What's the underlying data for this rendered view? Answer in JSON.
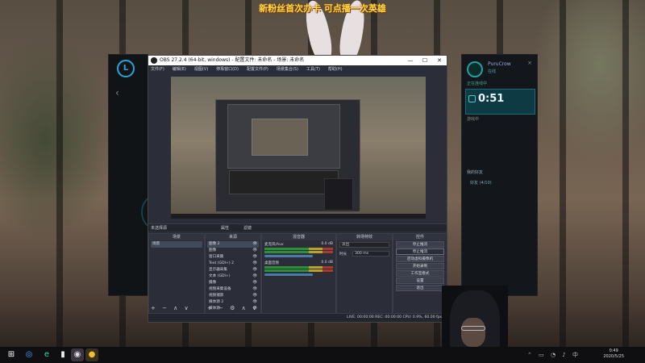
{
  "banner": "新粉丝首次办卡 可点播一次英雄",
  "right_app": {
    "username": "PuruCrow",
    "status": "在线",
    "close": "×",
    "hint_top": "正在连线中",
    "timer": "0:51",
    "hint_below": "游戏中",
    "section": "我的好友",
    "item": "好友 (4/10)"
  },
  "obs": {
    "title": "OBS 27.2.4 (64-bit, windows) - 配置文件: 未命名 - 场景: 未命名",
    "win_buttons": [
      "—",
      "☐",
      "✕"
    ],
    "menu": [
      "文件(F)",
      "编辑(E)",
      "视图(V)",
      "停靠窗口(D)",
      "配置文件(P)",
      "场景集合(S)",
      "工具(T)",
      "帮助(H)"
    ],
    "no_source": "未选择源",
    "properties": "属性",
    "filters": "滤镜",
    "docks": {
      "scenes": {
        "title": "场景",
        "items": [
          "场景"
        ],
        "footer": "+ − ∧ ∨"
      },
      "sources": {
        "title": "来源",
        "items": [
          "图像 2",
          "图像",
          "窗口采集",
          "Text (GDI+) 2",
          "显示器采集",
          "文本 (GDI+)",
          "摄像",
          "视频采集设备",
          "视频捕获",
          "媒体源 2",
          "媒体源"
        ],
        "footer": "+ − ⚙ ∧ ∨"
      },
      "mixer": {
        "title": "混音器",
        "channels": [
          {
            "name": "麦克风/Aux",
            "db": "0.0 dB"
          },
          {
            "name": "桌面音频",
            "db": "0.0 dB"
          }
        ]
      },
      "transitions": {
        "title": "转场特效",
        "type": "淡出",
        "duration_label": "时长",
        "duration": "300 ms"
      },
      "controls": {
        "title": "控件",
        "buttons": [
          "停止推流",
          "停止推流",
          "启动虚拟摄像机",
          "开始录制",
          "工作室模式",
          "设置",
          "退出"
        ]
      }
    },
    "status": "LIVE: 00:00:00   REC: 00:00:00   CPU: 0.9%, 60.00 fps"
  },
  "taskbar": {
    "icons": [
      "windows-icon",
      "search-icon",
      "edge-icon",
      "file-icon",
      "obs-icon",
      "app-icon"
    ],
    "time": "0:49",
    "date": "2020/5/25"
  }
}
